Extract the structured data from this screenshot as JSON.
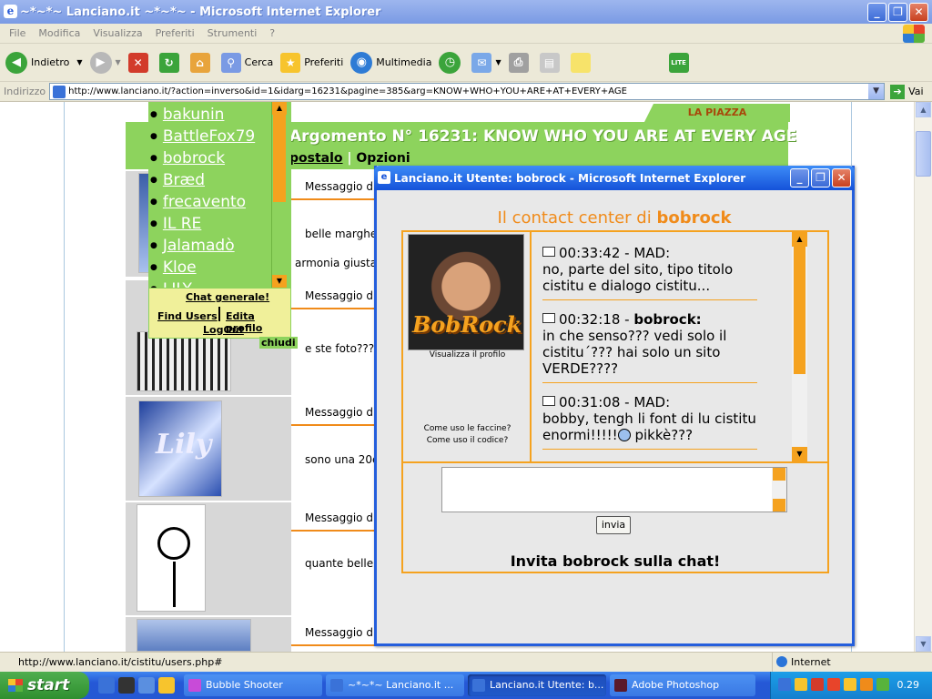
{
  "window": {
    "title": "~*~*~ Lanciano.it ~*~*~ - Microsoft Internet Explorer",
    "buttons": {
      "minimize": "_",
      "maximize": "❐",
      "close": "✕"
    }
  },
  "menu": [
    "File",
    "Modifica",
    "Visualizza",
    "Preferiti",
    "Strumenti",
    "?"
  ],
  "toolbar": {
    "back": "Indietro",
    "search": "Cerca",
    "favorites": "Preferiti",
    "media": "Multimedia",
    "lite": "LITE"
  },
  "address": {
    "label": "Indirizzo",
    "url": "http://www.lanciano.it/?action=inverso&id=1&idarg=16231&pagine=385&arg=KNOW+WHO+YOU+ARE+AT+EVERY+AGE",
    "go": "Vai"
  },
  "page": {
    "piazza_tab": "LA PIAZZA",
    "argument_title": "Argomento N° 16231: KNOW WHO YOU ARE AT EVERY AGE",
    "nav_postalo": "postalo",
    "nav_sep": "|",
    "nav_opzioni": "Opzioni",
    "messages": [
      {
        "head": "Messaggio d",
        "text": "belle marghe",
        "text2": "armonia giusta"
      },
      {
        "head": "Messaggio d",
        "text": "e ste foto???"
      },
      {
        "head": "Messaggio d",
        "text": "sono una 20e"
      },
      {
        "head": "Messaggio d",
        "text": "quante belle"
      },
      {
        "head": "Messaggio d",
        "text": ""
      }
    ],
    "chiudi": "chiudi"
  },
  "userlist": {
    "users": [
      "bakunin",
      "BattleFox79",
      "bobrock",
      "Bræd",
      "frecavento",
      "IL RE",
      "Jalamadò",
      "Kloe",
      "LILY"
    ],
    "chat_generale": "Chat generale!",
    "find_users": "Find Users",
    "edita_profilo": "Edita profilo",
    "logout": "LogOut"
  },
  "popup": {
    "title": "Lanciano.it Utente: bobrock - Microsoft Internet Explorer",
    "contact_prefix": "Il contact center di",
    "contact_user": "bobrock",
    "photo_logo": "BobRock",
    "view_profile": "Visualizza il profilo",
    "help_faces": "Come uso le faccine?",
    "help_code": "Come uso il codice?",
    "messages": [
      {
        "time": "00:33:42",
        "user": "MAD:",
        "text": "no, parte del sito, tipo titolo cistitu e dialogo cistitu..."
      },
      {
        "time": "00:32:18",
        "user": "bobrock:",
        "text": "in che senso??? vedi solo il cistitu´??? hai solo un sito VERDE????"
      },
      {
        "time": "00:31:08",
        "user": "MAD:",
        "text": "bobby, tengh li font di lu cistitu enormi!!!!!",
        "text_after": " pikkè???"
      }
    ],
    "send_label": "invia",
    "invite": "Invita bobrock sulla chat!"
  },
  "statusbar": {
    "url": "http://www.lanciano.it/cistitu/users.php#",
    "zone": "Internet"
  },
  "taskbar": {
    "start": "start",
    "tasks": [
      {
        "label": "Bubble Shooter",
        "color": "#c84bd8"
      },
      {
        "label": "~*~*~ Lanciano.it ...",
        "color": "#3a72d8"
      },
      {
        "label": "Lanciano.it Utente: b...",
        "color": "#3a72d8"
      },
      {
        "label": "Adobe Photoshop",
        "color": "#5a1a2a"
      }
    ],
    "clock": "0.29"
  }
}
